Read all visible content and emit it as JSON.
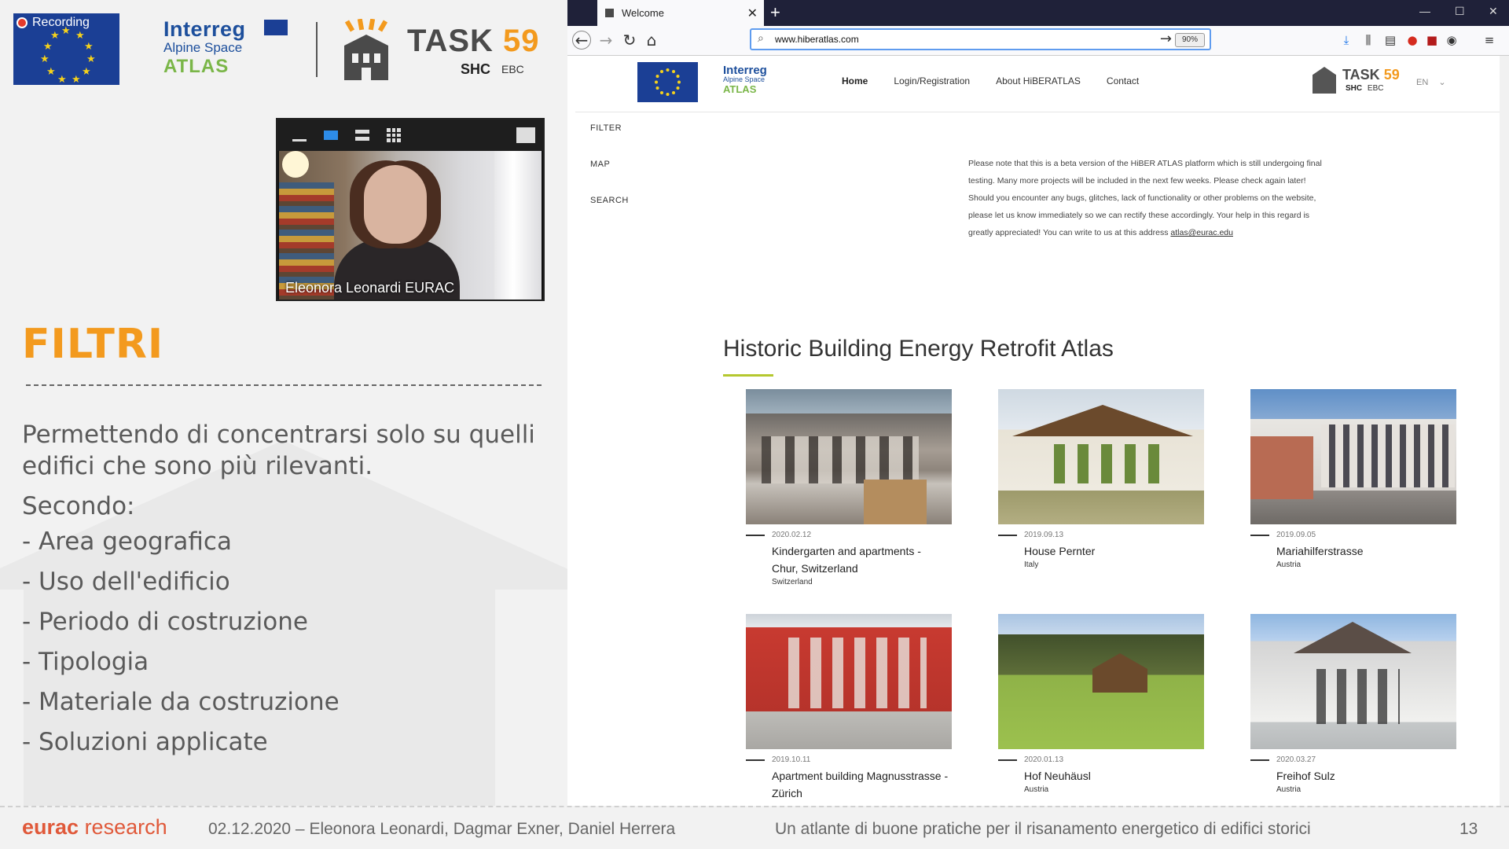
{
  "slide": {
    "recording_label": "Recording",
    "interreg": {
      "name": "Interreg",
      "sub": "Alpine Space",
      "atlas": "ATLAS"
    },
    "task": {
      "name": "TASK",
      "number": "59",
      "shc": "SHC",
      "ebc": "EBC"
    },
    "video": {
      "participant_name": "Eleonora Leonardi EURAC"
    },
    "title": "FILTRI",
    "intro": "Permettendo di concentrarsi solo su quelli edifici che sono più rilevanti.",
    "secondo": "Secondo:",
    "bullets": [
      "- Area geografica",
      "- Uso dell'edificio",
      "- Periodo di costruzione",
      "- Tipologia",
      "- Materiale da costruzione",
      "- Soluzioni applicate"
    ]
  },
  "browser": {
    "tab_title": "Welcome",
    "url": "www.hiberatlas.com",
    "zoom": "90%",
    "site": {
      "interreg": {
        "name": "Interreg",
        "sub": "Alpine Space",
        "atlas": "ATLAS"
      },
      "nav": [
        "Home",
        "Login/Registration",
        "About HiBERATLAS",
        "Contact"
      ],
      "task": {
        "name": "TASK",
        "number": "59",
        "shc": "SHC",
        "ebc": "EBC"
      },
      "lang": "EN",
      "side_links": [
        "FILTER",
        "MAP",
        "SEARCH"
      ],
      "beta_note": "Please note that this is a beta version of the HiBER ATLAS platform which is still undergoing final testing. Many more projects will be included in the next few weeks. Please check again later! Should you encounter any bugs, glitches, lack of functionality or other problems on the website, please let us know immediately so we can rectify these accordingly. Your help in this regard is greatly appreciated! You can write to us at this address",
      "beta_email": "atlas@eurac.edu",
      "atlas_title": "Historic Building Energy Retrofit Atlas",
      "cards": [
        {
          "date": "2020.02.12",
          "title": "Kindergarten and apartments - Chur, Switzerland",
          "country": "Switzerland"
        },
        {
          "date": "2019.09.13",
          "title": "House Pernter",
          "country": "Italy"
        },
        {
          "date": "2019.09.05",
          "title": "Mariahilferstrasse",
          "country": "Austria"
        },
        {
          "date": "2019.10.11",
          "title": "Apartment building Magnusstrasse - Zürich",
          "country": ""
        },
        {
          "date": "2020.01.13",
          "title": "Hof Neuhäusl",
          "country": "Austria"
        },
        {
          "date": "2020.03.27",
          "title": "Freihof Sulz",
          "country": "Austria"
        }
      ]
    }
  },
  "footer": {
    "logo_1": "eurac",
    "logo_2": " research",
    "info": "02.12.2020 – Eleonora Leonardi, Dagmar Exner, Daniel Herrera",
    "subtitle": "Un atlante di buone pratiche per il risanamento energetico di edifici storici",
    "page": "13"
  }
}
